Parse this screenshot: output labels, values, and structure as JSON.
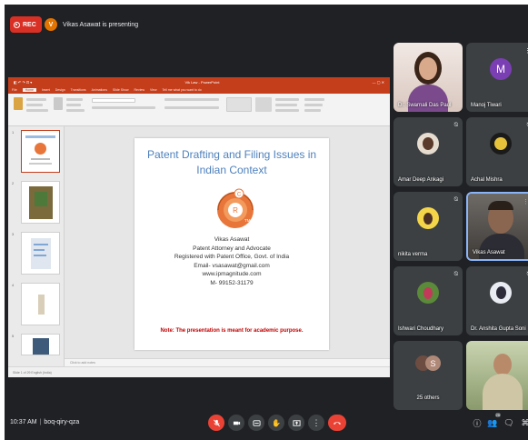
{
  "recording": {
    "label": "REC"
  },
  "presenting": {
    "initial": "V",
    "text": "Vikas Asawat is presenting"
  },
  "presentation": {
    "window_title": "Vik Law - PowerPoint",
    "ribbon_tabs": [
      "File",
      "Home",
      "Insert",
      "Design",
      "Transitions",
      "Animations",
      "Slide Show",
      "Review",
      "View",
      "Tell me what you want to do"
    ],
    "slide": {
      "title": "Patent Drafting and Filing Issues in Indian Context",
      "lines": [
        "Vikas Asawat",
        "Patent Attorney and Advocate",
        "Registered with Patent Office, Govt. of India",
        "Email- vsasawat@gmail.com",
        "www.ipmagnitude.com",
        "M- 99152-31179"
      ],
      "note": "Note: The presentation is meant for academic purpose."
    },
    "notes_placeholder": "Click to add notes",
    "status": "Slide 1 of 29   English (India)"
  },
  "participants": [
    {
      "name": "Dr. Swarnali Das Paul"
    },
    {
      "name": "Manoj Tiwari",
      "initial": "M"
    },
    {
      "name": "Amar Deep Ankagi"
    },
    {
      "name": "Achal Mishra"
    },
    {
      "name": "nikita verma"
    },
    {
      "name": "Vikas Asawat"
    },
    {
      "name": "Ishwari Choudhary"
    },
    {
      "name": "Dr. Anshita Gupta Soni"
    },
    {
      "name": "25 others",
      "initial": "S"
    },
    {
      "name": ""
    }
  ],
  "meeting": {
    "time": "10:37 AM",
    "code": "boq-qiry-qza"
  },
  "right_controls": {
    "people_count": "29"
  },
  "colors": {
    "accent": "#8ab4f8",
    "danger": "#ea4335",
    "background": "#202124",
    "tile": "#3c4043",
    "powerpoint": "#c43e1c"
  }
}
